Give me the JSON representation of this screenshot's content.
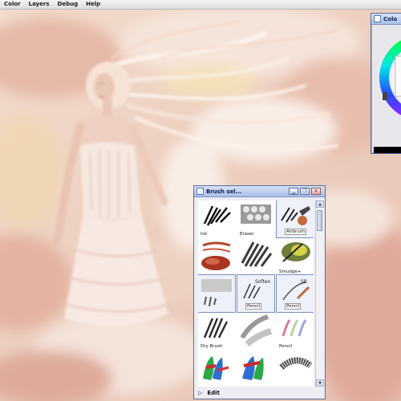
{
  "menubar": {
    "items": [
      "Color",
      "Layers",
      "Debug",
      "Help"
    ]
  },
  "color_panel": {
    "title": "Colo"
  },
  "brush_panel": {
    "title": "Brush sel...",
    "titlebar_buttons": [
      "minimize",
      "restore",
      "close"
    ],
    "brushes": [
      {
        "label": "Ink"
      },
      {
        "label": "Eraser"
      },
      {
        "label": "Airbrush"
      },
      {
        "label": ""
      },
      {
        "label": ""
      },
      {
        "label": "Smudge+"
      },
      {
        "label": ""
      },
      {
        "label": "Pencil"
      },
      {
        "label": "Pencil"
      },
      {
        "label": "Dry Brush"
      },
      {
        "label": ""
      },
      {
        "label": "Pencil"
      },
      {
        "label": ""
      },
      {
        "label": ""
      },
      {
        "label": ""
      }
    ],
    "cell_overlay_labels": {
      "soften": "Soften",
      "sb": "SB"
    },
    "footer_label": "Edit",
    "footer_arrow": "▷"
  },
  "icons": {
    "panel_title_icon": "window-icon",
    "scroll_up": "arrow-up-icon",
    "scroll_down": "arrow-down-icon"
  },
  "colors": {
    "titlebar_top": "#d7e2f6",
    "titlebar_bottom": "#a9bfe6",
    "panel_border": "#5a6f9a"
  }
}
